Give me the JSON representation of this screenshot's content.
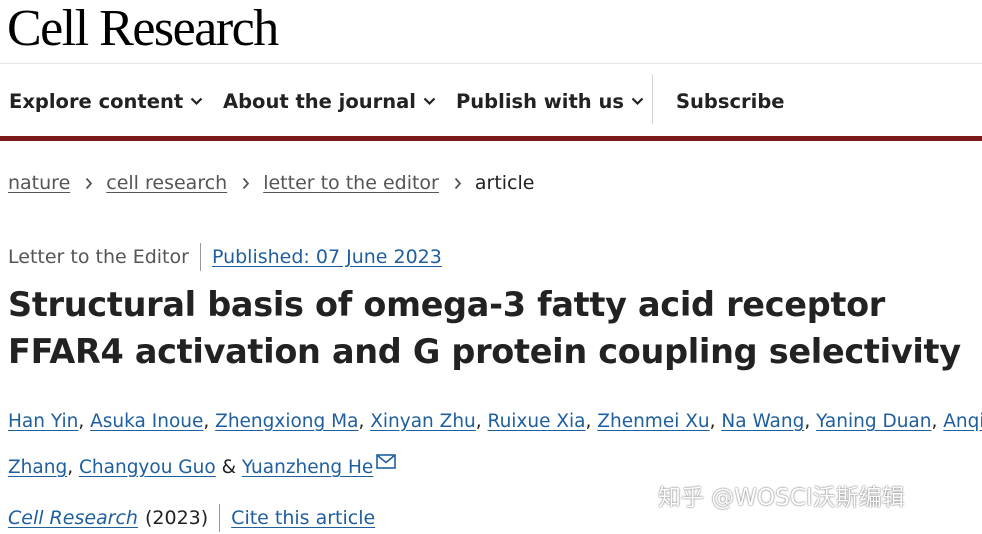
{
  "header": {
    "logo": "Cell Research"
  },
  "nav": {
    "items": [
      {
        "label": "Explore content",
        "has_dropdown": true
      },
      {
        "label": "About the journal",
        "has_dropdown": true
      },
      {
        "label": "Publish with us",
        "has_dropdown": true
      },
      {
        "label": "Subscribe",
        "has_dropdown": false
      }
    ]
  },
  "breadcrumbs": {
    "items": [
      "nature",
      "cell research",
      "letter to the editor"
    ],
    "current": "article"
  },
  "article": {
    "type": "Letter to the Editor",
    "published": "Published: 07 June 2023",
    "title": "Structural basis of omega-3 fatty acid receptor FFAR4 activation and G protein coupling selectivity",
    "authors": {
      "line1": [
        "Han Yin",
        "Asuka Inoue",
        "Zhengxiong Ma",
        "Xinyan Zhu",
        "Ruixue Xia",
        "Zhenmei Xu",
        "Na Wang",
        "Yaning Duan",
        "Anqi"
      ],
      "line2": [
        "Zhang",
        "Changyou Guo",
        "Yuanzheng He"
      ],
      "separator": ", ",
      "ampersand": " & "
    },
    "journal": "Cell Research",
    "year": "(2023)",
    "cite_label": "Cite this article"
  },
  "watermark": {
    "text": "知乎 @WOSCI沃斯编辑"
  },
  "colors": {
    "accent_bar": "#7b1a1a",
    "link": "#1f5fa0",
    "text": "#222222",
    "muted": "#555555"
  },
  "icons": [
    "chevron-down-icon",
    "chevron-right-icon",
    "envelope-icon"
  ]
}
